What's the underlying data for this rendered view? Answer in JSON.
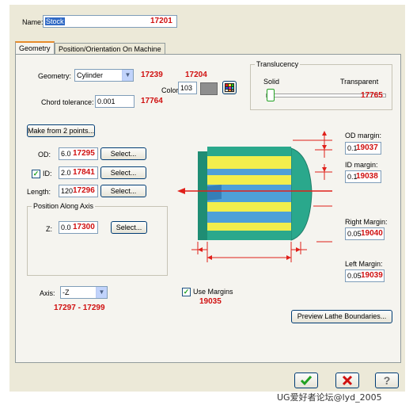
{
  "header": {
    "name_label": "Name:",
    "name_value": "Stock",
    "name_code": "17201"
  },
  "tabs": [
    {
      "label": "Geometry",
      "active": true
    },
    {
      "label": "Position/Orientation On Machine",
      "active": false
    }
  ],
  "geometry": {
    "label": "Geometry:",
    "value": "Cylinder",
    "code": "17239",
    "chord_label": "Chord tolerance:",
    "chord_value": "0.001",
    "chord_code": "17764"
  },
  "color": {
    "label": "Color:",
    "value": "103",
    "code": "17204"
  },
  "translucency": {
    "title": "Translucency",
    "solid": "Solid",
    "transparent": "Transparent",
    "code": "17765",
    "level": 0.0
  },
  "make_button": "Make from 2 points...",
  "od": {
    "label": "OD:",
    "value": "6.0",
    "code": "17295",
    "select": "Select..."
  },
  "id": {
    "label": "ID:",
    "checked": true,
    "value": "2.0",
    "code": "17841",
    "select": "Select..."
  },
  "length": {
    "label": "Length:",
    "value": "120",
    "code": "17296",
    "select": "Select..."
  },
  "position": {
    "title": "Position Along Axis",
    "z_label": "Z:",
    "z_value": "0.0",
    "code": "17300",
    "select": "Select..."
  },
  "margins": {
    "od_label": "OD margin:",
    "od_value": "0.1",
    "od_code": "19037",
    "id_label": "ID margin:",
    "id_value": "0.1",
    "id_code": "19038",
    "right_label": "Right Margin:",
    "right_value": "0.05",
    "right_code": "19040",
    "left_label": "Left Margin:",
    "left_value": "0.05",
    "left_code": "19039"
  },
  "axis": {
    "label": "Axis:",
    "value": "-Z",
    "code": "17297 - 17299"
  },
  "use_margins": {
    "label": "Use Margins",
    "checked": true,
    "code": "19035"
  },
  "preview_button": "Preview Lathe Boundaries...",
  "footer": {
    "ok_icon": "check-icon",
    "cancel_icon": "x-icon",
    "help_icon": "question-icon"
  },
  "watermark": "UG爱好者论坛@lyd_2005",
  "colors": {
    "code_red": "#d01010",
    "stock_teal": "#2aa88c",
    "stock_yellow": "#f2ee4c",
    "stock_blue": "#4ea0d8",
    "dim_red": "#e0201a"
  }
}
